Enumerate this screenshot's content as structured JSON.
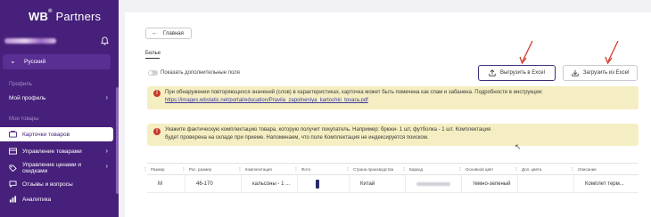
{
  "sidebar": {
    "logo_brand": "WB",
    "logo_sup": "®",
    "logo_product": "Partners",
    "language": "Русский",
    "sections": {
      "profile": "Профиль",
      "goods": "Мои товары"
    },
    "items": [
      {
        "label": "Мой профиль",
        "icon": "user-icon"
      },
      {
        "label": "Карточки товаров",
        "icon": "cards-icon"
      },
      {
        "label": "Управление товарами",
        "icon": "box-icon"
      },
      {
        "label": "Управление ценами и скидками",
        "icon": "tag-icon"
      },
      {
        "label": "Отзывы и вопросы",
        "icon": "chat-icon"
      },
      {
        "label": "Аналитика",
        "icon": "chart-icon"
      }
    ]
  },
  "main": {
    "back_label": "Главная",
    "tab_label": "Белье",
    "toggle_label": "Показать дополнительные поля",
    "export_label": "Выгрузить в Excel",
    "import_label": "Загрузить из Excel",
    "notice1_text": "При обнаружении повторяющихся значений (слов) в характеристиках, карточка может быть помечена как спам и забанена. Подробности в инструкции:",
    "notice1_link": "https://images.wbstatic.net/portal/education/Pravila_zapolneniya_kartochki_tovara.pdf",
    "notice2_text": "Укажите фактическую комплектацию товара, которую получит покупатель. Например: брюки- 1 шт, футболка - 1 шт. Комплектация будет проверена на складе при приеме. Напоминаем, что поле Комплектация не индексируется поиском.",
    "table": {
      "headers": [
        "Размер",
        "Рос. размер",
        "Комплектация",
        "Фото",
        "Страна производства",
        "Баркод",
        "Основной цвет",
        "Доп. цвета",
        "Описание"
      ],
      "row": {
        "size": "М",
        "ru_size": "46-170",
        "set": "кальсоны - 1 ...",
        "country": "Китай",
        "main_color": "темно-зеленый",
        "description": "Комплет терм..."
      }
    }
  },
  "colors": {
    "sidebar": "#46207a",
    "notice": "#f5eec2",
    "annotation": "#d43a2a"
  }
}
